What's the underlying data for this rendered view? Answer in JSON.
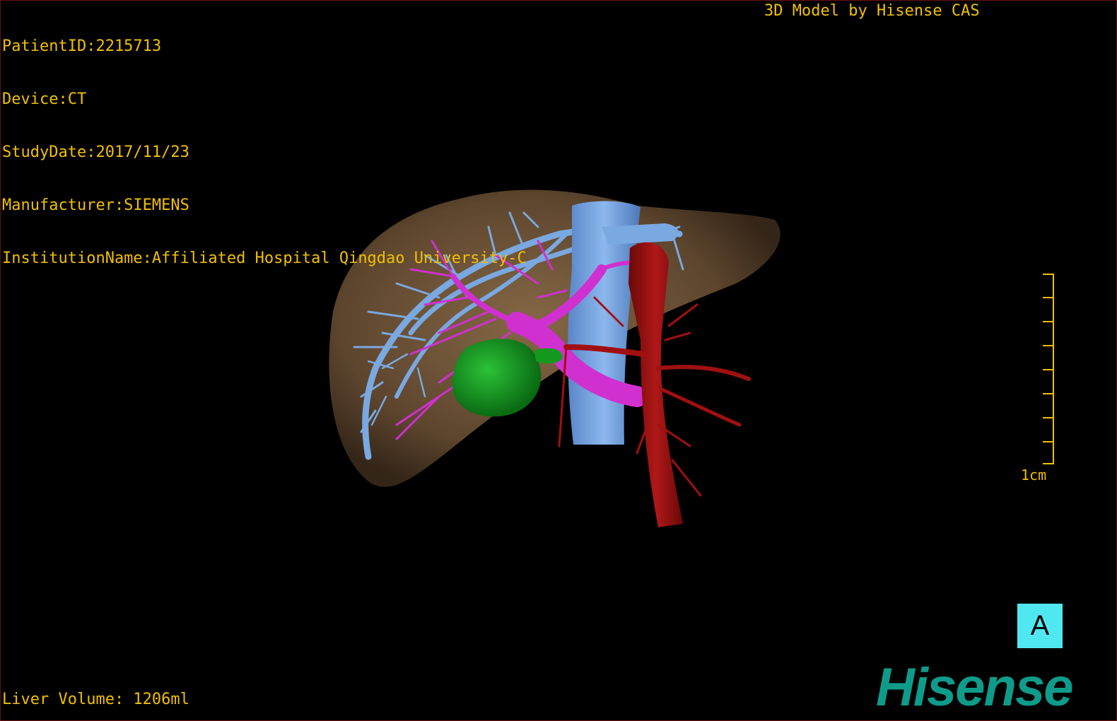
{
  "overlay": {
    "patient_id": "PatientID:2215713",
    "device": "Device:CT",
    "study_date": "StudyDate:2017/11/23",
    "manufacturer": "Manufacturer:SIEMENS",
    "institution": "InstitutionName:Affiliated Hospital Qingdao University-C",
    "credit": "3D Model by Hisense CAS",
    "liver_volume": "Liver Volume: 1206ml"
  },
  "scale_bar": {
    "label": "1cm"
  },
  "view_orientation": {
    "label": "A"
  },
  "brand": {
    "logo_text": "Hisense",
    "color": "#0f9b89"
  },
  "colors": {
    "overlay_text": "#f0c000",
    "liver": "#8a6a45",
    "portal_vein": "#d030d0",
    "hepatic_vein": "#7aa8e0",
    "artery": "#a01010",
    "tumor": "#139a1e",
    "view_button": "#4fe8f0"
  }
}
